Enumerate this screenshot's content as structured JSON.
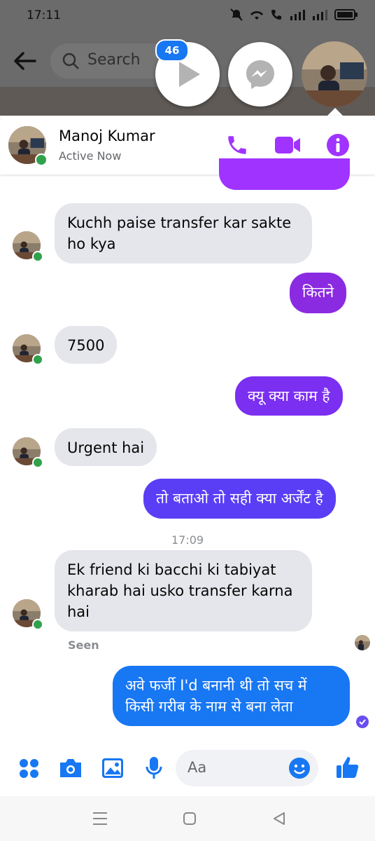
{
  "status_bar": {
    "time": "17:11"
  },
  "search": {
    "placeholder": "Search"
  },
  "chat_heads": {
    "badge_count": "46"
  },
  "header": {
    "name": "Manoj Kumar",
    "status": "Active Now"
  },
  "messages": [
    {
      "from": "them",
      "text": "Kuchh paise transfer kar sakte ho kya"
    },
    {
      "from": "me",
      "text": "कितने",
      "color": "#8a2be2"
    },
    {
      "from": "them",
      "text": "7500"
    },
    {
      "from": "me",
      "text": "क्यू क्या काम है",
      "color": "#7b2ff0"
    },
    {
      "from": "them",
      "text": "Urgent hai"
    },
    {
      "from": "me",
      "text": "तो बताओ तो सही क्या अर्जेंट है",
      "color": "#5a3ef5"
    },
    {
      "timestamp": "17:09"
    },
    {
      "from": "them",
      "text": "Ek friend ki bacchi ki tabiyat kharab hai usko transfer karna hai"
    },
    {
      "seen_label": "Seen"
    },
    {
      "from": "me",
      "text": "अवे फर्जी I'd बनानी थी तो सच में किसी गरीब के नाम से बना लेता",
      "color": "#1877f2"
    }
  ],
  "composer": {
    "placeholder": "Aa"
  },
  "colors": {
    "accent": "#a033ff",
    "online": "#31a24c",
    "incoming_bubble": "#e4e6eb",
    "badge": "#1877f2"
  },
  "icons": [
    "back-arrow-icon",
    "search-icon",
    "play-icon",
    "messenger-icon",
    "phone-icon",
    "video-camera-icon",
    "info-icon",
    "menu-dots-icon",
    "camera-icon",
    "gallery-icon",
    "microphone-icon",
    "emoji-icon",
    "thumbs-up-icon",
    "recents-icon",
    "home-icon",
    "back-icon"
  ]
}
